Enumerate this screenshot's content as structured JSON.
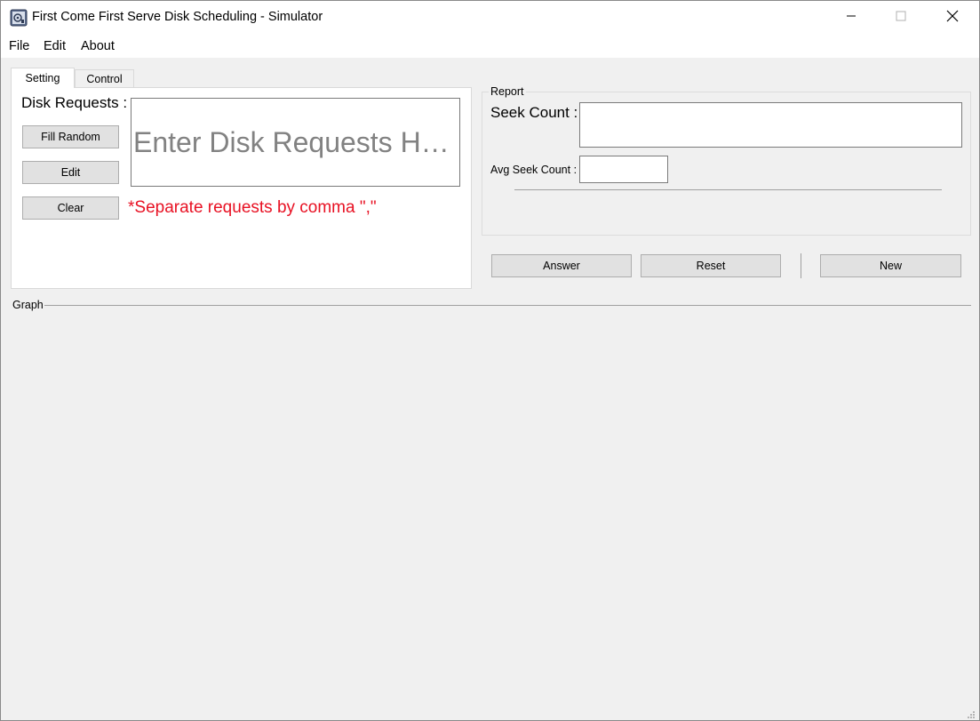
{
  "window": {
    "title": "First Come First Serve Disk Scheduling - Simulator",
    "minimize_glyph": "—",
    "maximize_glyph": "☐",
    "close_glyph": "✕"
  },
  "menu": {
    "items": [
      "File",
      "Edit",
      "About"
    ]
  },
  "tabs": [
    {
      "label": "Setting",
      "active": true
    },
    {
      "label": "Control",
      "active": false
    }
  ],
  "setting": {
    "disk_requests_label": "Disk Requests :",
    "disk_requests_value": "",
    "disk_requests_placeholder": "Enter Disk Requests Here",
    "fill_random_label": "Fill Random",
    "edit_label": "Edit",
    "clear_label": "Clear",
    "separator_note": "*Separate requests by comma \",\""
  },
  "report": {
    "title": "Report",
    "seek_count_label": "Seek Count :",
    "seek_count_value": "",
    "avg_seek_count_label": "Avg Seek Count :",
    "avg_seek_count_value": ""
  },
  "actions": {
    "answer_label": "Answer",
    "reset_label": "Reset",
    "new_label": "New"
  },
  "graph": {
    "title": "Graph"
  },
  "colors": {
    "note_red": "#e81123",
    "background": "#f0f0f0",
    "button_face": "#e1e1e1",
    "placeholder_gray": "#828282"
  },
  "icons": {
    "app": "app-disk-icon",
    "minimize": "minimize-icon",
    "maximize": "maximize-icon",
    "close": "close-icon",
    "resize": "resize-grip-icon"
  }
}
